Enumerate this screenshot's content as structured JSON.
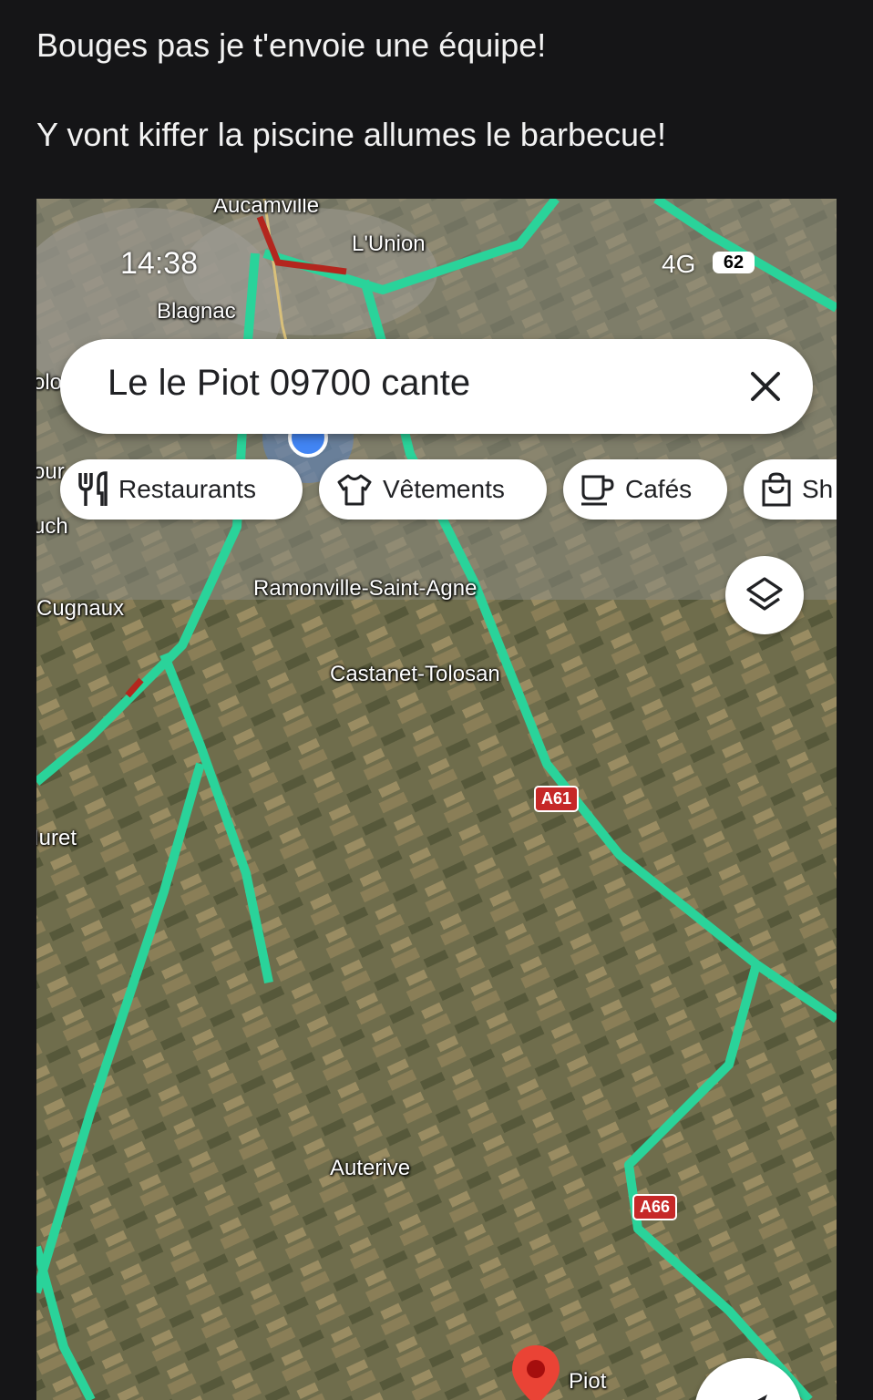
{
  "message": {
    "line1": "Bouges pas je t'envoie une équipe!",
    "line2": "Y vont kiffer la piscine allumes le barbecue!"
  },
  "status_bar": {
    "time": "14:38",
    "network": "4G",
    "battery": "62"
  },
  "search": {
    "value": "Le le Piot 09700 cante",
    "close_icon": "close-icon"
  },
  "chips": [
    {
      "label": "Restaurants",
      "icon": "fork-knife-icon"
    },
    {
      "label": "Vêtements",
      "icon": "tshirt-icon"
    },
    {
      "label": "Cafés",
      "icon": "coffee-cup-icon"
    },
    {
      "label": "Sh",
      "icon": "shopping-bag-icon"
    }
  ],
  "map": {
    "places": {
      "aucamville": "Aucamville",
      "lunion": "L'Union",
      "blagnac": "Blagnac",
      "tolo": "olo",
      "pur": "our",
      "plaisance": "uch",
      "cugnaux": "Cugnaux",
      "ramonville": "Ramonville-Saint-Agne",
      "castanet": "Castanet-Tolosan",
      "muret": "Iuret",
      "auterive": "Auterive",
      "piot": "Piot"
    },
    "road_shields": {
      "a61": "A61",
      "a66": "A66"
    }
  },
  "colors": {
    "route": "#2ad39a",
    "traffic_red": "#b3261e",
    "pin": "#ea4335",
    "location": "#4285f4"
  }
}
